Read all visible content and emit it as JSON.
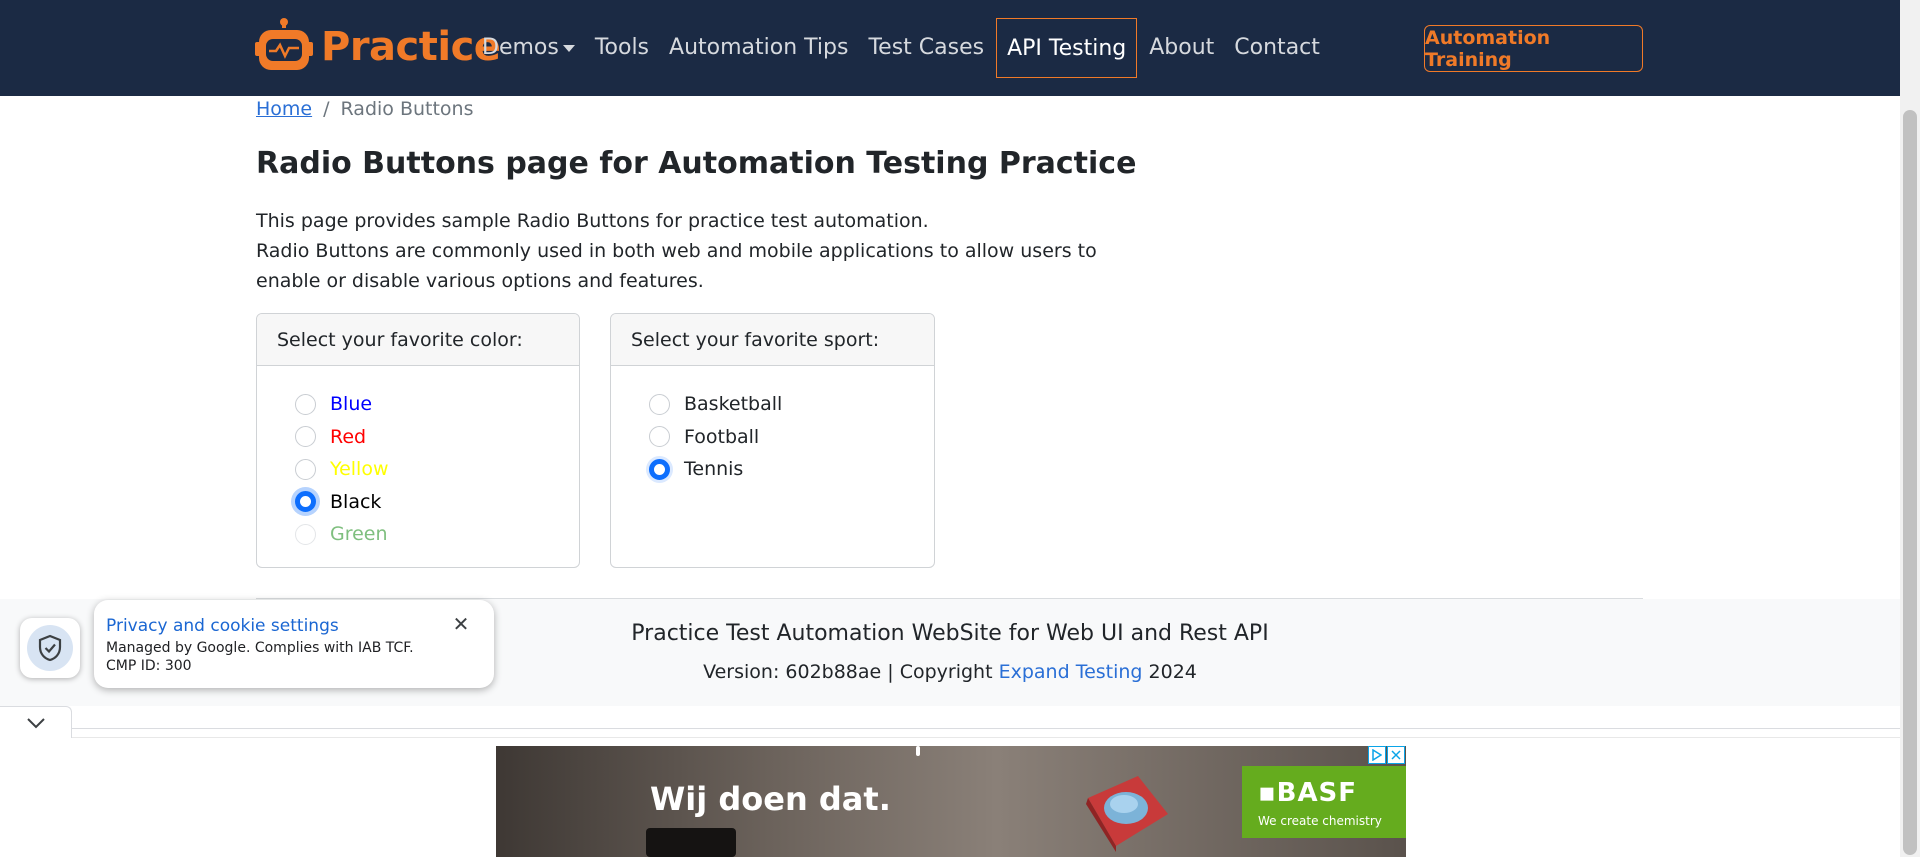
{
  "nav": {
    "brand": "Practice",
    "links": [
      {
        "label": "Demos",
        "dropdown": true
      },
      {
        "label": "Tools"
      },
      {
        "label": "Automation Tips"
      },
      {
        "label": "Test Cases"
      },
      {
        "label": "API Testing",
        "active": true
      },
      {
        "label": "About"
      },
      {
        "label": "Contact"
      }
    ],
    "cta": "Automation Training"
  },
  "breadcrumb": {
    "home": "Home",
    "separator": "/",
    "current": "Radio Buttons"
  },
  "page": {
    "title": "Radio Buttons page for Automation Testing Practice",
    "intro_1": "This page provides sample Radio Buttons for practice test automation.",
    "intro_2": "Radio Buttons are commonly used in both web and mobile applications to allow users to enable or disable various options and features."
  },
  "color_card": {
    "header": "Select your favorite color:",
    "options": [
      {
        "label": "Blue",
        "color": "#0000ff",
        "checked": false,
        "disabled": false
      },
      {
        "label": "Red",
        "color": "#ff0000",
        "checked": false,
        "disabled": false
      },
      {
        "label": "Yellow",
        "color": "#ffff00",
        "checked": false,
        "disabled": false
      },
      {
        "label": "Black",
        "color": "#000000",
        "checked": true,
        "disabled": false
      },
      {
        "label": "Green",
        "color": "#7fbf7f",
        "checked": false,
        "disabled": true
      }
    ]
  },
  "sport_card": {
    "header": "Select your favorite sport:",
    "options": [
      {
        "label": "Basketball",
        "checked": false
      },
      {
        "label": "Football",
        "checked": false
      },
      {
        "label": "Tennis",
        "checked": true
      }
    ]
  },
  "footer": {
    "title": "Practice Test Automation WebSite for Web UI and Rest API",
    "version_prefix": "Version: 602b88ae | Copyright ",
    "company": "Expand Testing",
    "year": " 2024"
  },
  "cookie": {
    "title": "Privacy and cookie settings",
    "line1": "Managed by Google. Complies with IAB TCF.",
    "line2": "CMP ID: 300",
    "close": "✕"
  },
  "ad": {
    "headline": "Wij doen dat.",
    "logo": "▪BASF",
    "tagline": "We create chemistry"
  },
  "colors": {
    "nav_bg": "#1b2a44",
    "brand_orange": "#f07a28",
    "link_blue": "#2a6fd6",
    "radio_blue": "#0d6efd"
  }
}
